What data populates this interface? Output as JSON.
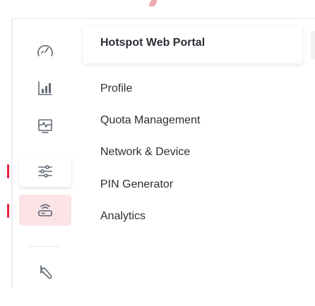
{
  "colors": {
    "accent": "#e5233d",
    "active_bg": "#fbe3e6",
    "icon": "#606873",
    "text": "#2b2f36"
  },
  "rail": {
    "items": [
      {
        "icon": "gauge-icon",
        "active": false
      },
      {
        "icon": "bar-chart-icon",
        "active": false
      },
      {
        "icon": "monitor-icon",
        "active": false
      },
      {
        "icon": "sliders-icon",
        "active": false,
        "marked": true
      },
      {
        "icon": "wifi-router-icon",
        "active": true,
        "marked": true
      },
      {
        "icon": "wrench-icon",
        "active": false
      }
    ]
  },
  "submenu": {
    "title": "Hotspot Web Portal",
    "items": [
      {
        "label": "Profile"
      },
      {
        "label": "Quota Management"
      },
      {
        "label": "Network & Device"
      },
      {
        "label": "PIN Generator"
      },
      {
        "label": "Analytics"
      }
    ]
  }
}
